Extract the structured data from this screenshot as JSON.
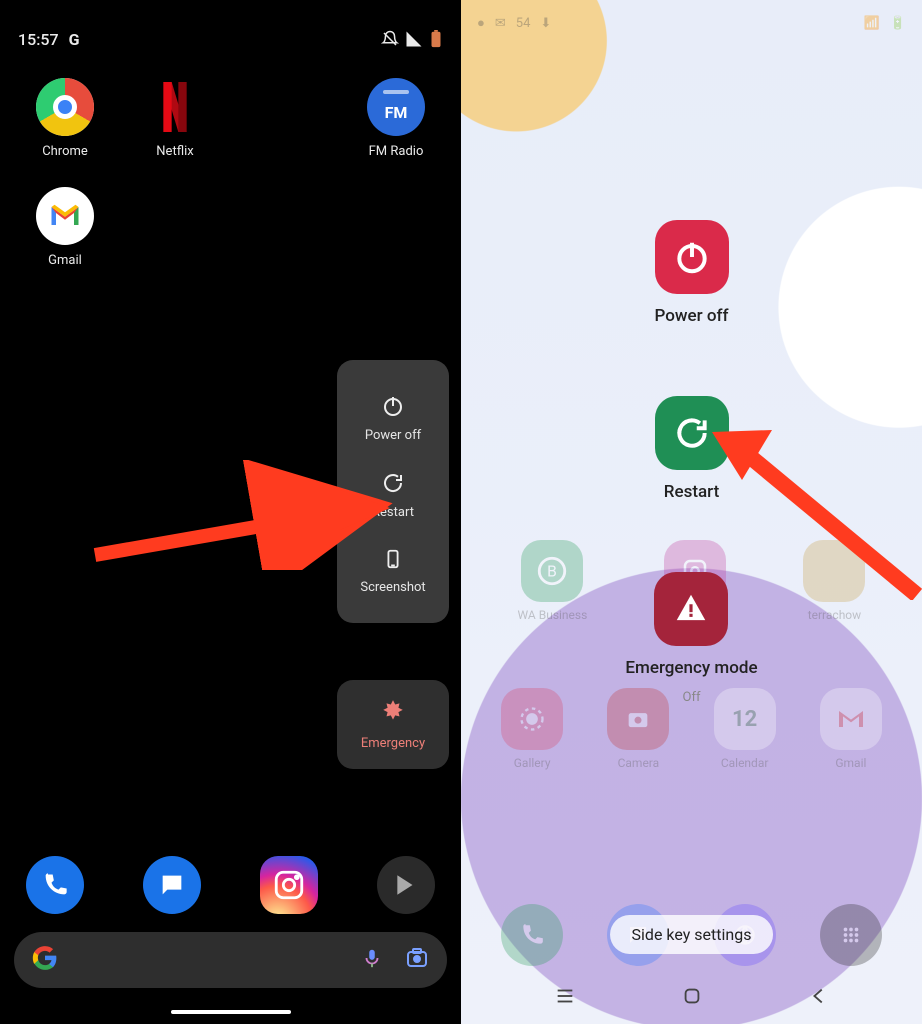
{
  "left": {
    "status": {
      "time": "15:57",
      "indicator_letter": "G"
    },
    "apps_row1": [
      {
        "name": "chrome",
        "label": "Chrome"
      },
      {
        "name": "netflix",
        "label": "Netflix"
      },
      {
        "name": "fm-radio",
        "label": "FM Radio",
        "badge": "FM"
      }
    ],
    "apps_row2": [
      {
        "name": "gmail",
        "label": "Gmail"
      }
    ],
    "power_menu": {
      "items": [
        {
          "id": "power-off",
          "label": "Power off"
        },
        {
          "id": "restart",
          "label": "Restart"
        },
        {
          "id": "screenshot",
          "label": "Screenshot"
        }
      ],
      "emergency_label": "Emergency"
    },
    "dock": [
      "phone",
      "messages",
      "instagram",
      "play"
    ]
  },
  "right": {
    "status_time": "54",
    "power_menu": [
      {
        "id": "power-off",
        "label": "Power off"
      },
      {
        "id": "restart",
        "label": "Restart"
      },
      {
        "id": "emergency",
        "label": "Emergency mode",
        "sub": "Off"
      }
    ],
    "faded_apps_row1": [
      {
        "label": "WA Business"
      },
      {
        "label": "Instagram"
      },
      {
        "label": "terrachow"
      }
    ],
    "faded_apps_row2": [
      {
        "label": "Gallery",
        "badge": ""
      },
      {
        "label": "Camera",
        "badge": ""
      },
      {
        "label": "Calendar",
        "badge": "12"
      },
      {
        "label": "Gmail",
        "badge": ""
      }
    ],
    "side_key_label": "Side key settings"
  }
}
